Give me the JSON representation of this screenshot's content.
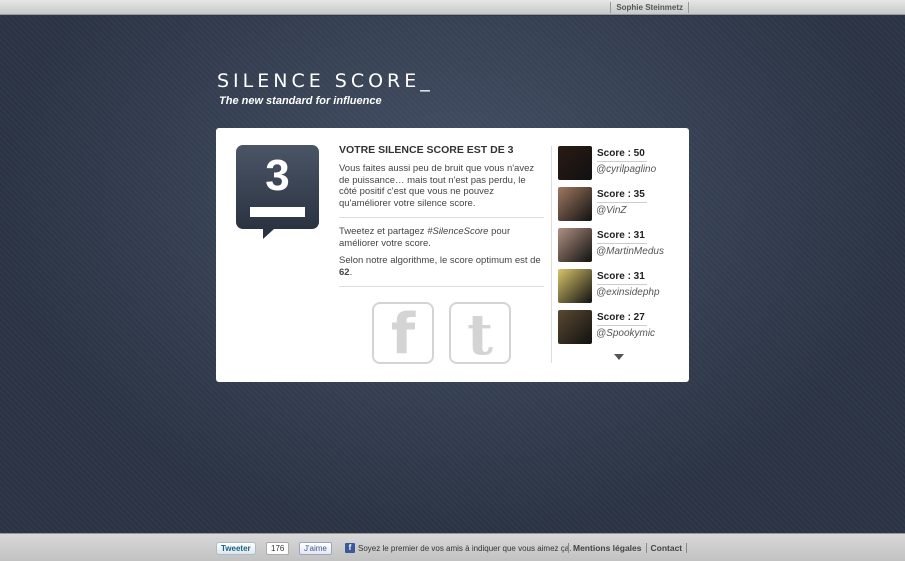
{
  "topbar": {
    "user_name": "Sophie Steinmetz"
  },
  "brand": {
    "logo": "SILENCE SCORE_",
    "tagline": "The new standard for influence"
  },
  "result": {
    "score": "3",
    "heading": "VOTRE SILENCE SCORE EST DE 3",
    "message": "Vous faites aussi peu de bruit que vous n'avez de puissance… mais tout n'est pas perdu, le côté positif c'est que vous ne pouvez qu'améliorer votre silence score.",
    "share_prefix": "Tweetez et partagez ",
    "share_hashtag": "#SilenceScore",
    "share_suffix": " pour améliorer votre score.",
    "optimum_prefix": "Selon notre algorithme, le score optimum est de ",
    "optimum_value": "62",
    "optimum_suffix": "."
  },
  "social": {
    "facebook_glyph": "f",
    "twitter_glyph": "t",
    "facebook_icon": "facebook-icon",
    "twitter_icon": "twitter-icon"
  },
  "leaderboard": [
    {
      "score": "Score : 50",
      "handle": "@cyrilpaglino",
      "avatar_color": "#2a1a14"
    },
    {
      "score": "Score : 35",
      "handle": "@VinZ",
      "avatar_color": "#a07860"
    },
    {
      "score": "Score : 31",
      "handle": "@MartinMedus",
      "avatar_color": "#b09080"
    },
    {
      "score": "Score : 31",
      "handle": "@exinsidephp",
      "avatar_color": "#d9c46a"
    },
    {
      "score": "Score : 27",
      "handle": "@Spookymic",
      "avatar_color": "#5a4a30"
    }
  ],
  "footer": {
    "tweet_label": "Tweeter",
    "tweet_count": "176",
    "like_label": "J'aime",
    "like_text": "Soyez le premier de vos amis à indiquer que vous aimez ça.",
    "legal_link": "Mentions légales",
    "contact_link": "Contact"
  },
  "colors": {
    "background": "#2e3849",
    "panel": "#ffffff",
    "badge": "#2b3341"
  }
}
